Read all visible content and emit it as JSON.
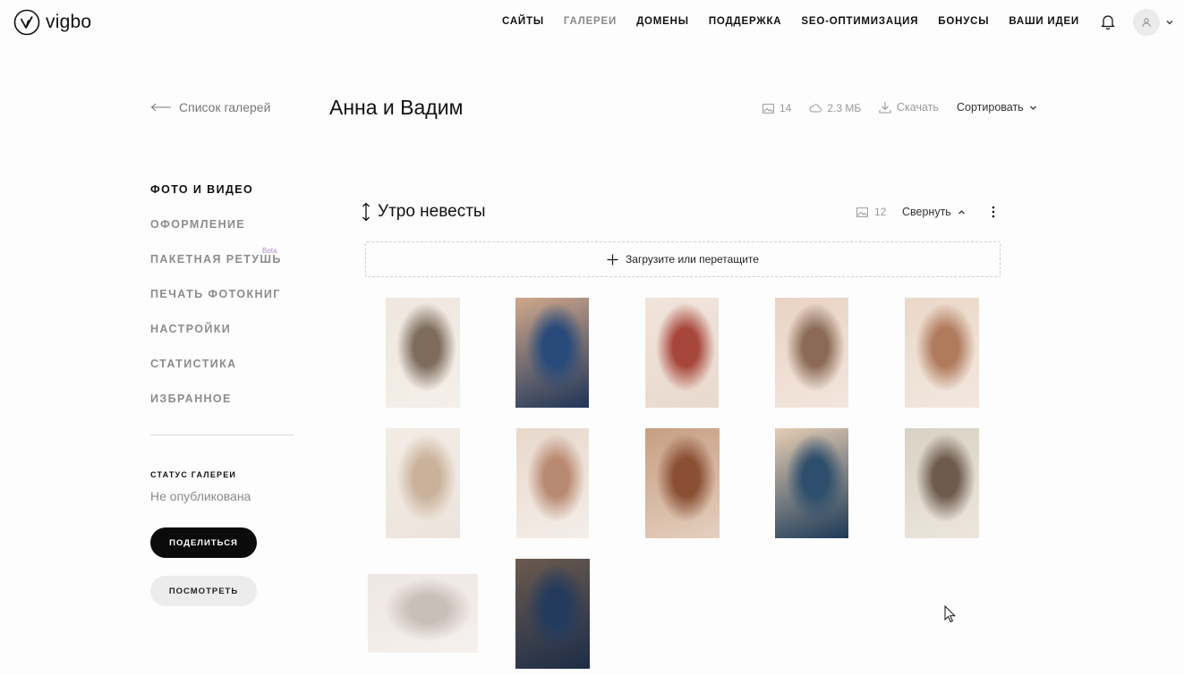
{
  "header": {
    "logo_text": "vigbo",
    "nav": [
      {
        "label": "САЙТЫ",
        "active": false
      },
      {
        "label": "ГАЛЕРЕИ",
        "active": true
      },
      {
        "label": "ДОМЕНЫ",
        "active": false
      },
      {
        "label": "ПОДДЕРЖКА",
        "active": false
      },
      {
        "label": "SEO-ОПТИМИЗАЦИЯ",
        "active": false
      },
      {
        "label": "БОНУСЫ",
        "active": false
      },
      {
        "label": "ВАШИ ИДЕИ",
        "active": false
      }
    ],
    "icons": {
      "notifications": "bell-icon",
      "user": "user-icon",
      "menu": "chevron-down-icon"
    }
  },
  "toolbar": {
    "back_label": "Список галерей",
    "gallery_title": "Анна и Вадим",
    "photo_count": "14",
    "size": "2.3 МБ",
    "download_label": "Скачать",
    "sort_label": "Сортировать"
  },
  "sidebar": {
    "items": [
      {
        "label": "ФОТО И ВИДЕО",
        "active": true
      },
      {
        "label": "ОФОРМЛЕНИЕ",
        "active": false
      },
      {
        "label": "ПАКЕТНАЯ РЕТУШЬ",
        "active": false,
        "badge": "Beta"
      },
      {
        "label": "ПЕЧАТЬ ФОТОКНИГ",
        "active": false
      },
      {
        "label": "НАСТРОЙКИ",
        "active": false
      },
      {
        "label": "СТАТИСТИКА",
        "active": false
      },
      {
        "label": "ИЗБРАННОЕ",
        "active": false
      }
    ],
    "status_label": "СТАТУС ГАЛЕРЕИ",
    "status_value": "Не опубликована",
    "share_label": "ПОДЕЛИТЬСЯ",
    "view_label": "ПОСМОТРЕТЬ"
  },
  "section": {
    "title": "Утро невесты",
    "count": "12",
    "collapse_label": "Свернуть",
    "upload_label": "Загрузите или перетащите"
  },
  "photos": [
    {
      "name": "photo-bride-mirror",
      "colors": [
        "#efe7df",
        "#7d6b5c",
        "#f4efe9"
      ]
    },
    {
      "name": "photo-groom-suit",
      "colors": [
        "#cfa88c",
        "#274a7a",
        "#1f3558"
      ]
    },
    {
      "name": "photo-red-shoes",
      "colors": [
        "#f1e4db",
        "#a7463b",
        "#e9d9cd"
      ]
    },
    {
      "name": "photo-rings-table",
      "colors": [
        "#e9d3c4",
        "#8b6b58",
        "#f3e6dd"
      ]
    },
    {
      "name": "photo-dress-lace-back",
      "colors": [
        "#ead8c8",
        "#b07a5c",
        "#f2e8e0"
      ]
    },
    {
      "name": "photo-bride-window",
      "colors": [
        "#f3ece5",
        "#c9b19a",
        "#ece4dc"
      ]
    },
    {
      "name": "photo-dress-buttons",
      "colors": [
        "#e8d8cc",
        "#b98a72",
        "#f4eee9"
      ]
    },
    {
      "name": "photo-mirror-shoes",
      "colors": [
        "#c79f82",
        "#8a4f35",
        "#e4cfbf"
      ]
    },
    {
      "name": "photo-dress-bed",
      "colors": [
        "#e6cdb4",
        "#2d4e6c",
        "#1c3a57"
      ]
    },
    {
      "name": "photo-bride-portrait",
      "colors": [
        "#d8d2c4",
        "#6f5b4e",
        "#ede6dd"
      ]
    },
    {
      "name": "photo-shoes-floor",
      "colors": [
        "#eee6e2",
        "#c9bfb9",
        "#f5f1ee"
      ]
    },
    {
      "name": "photo-groom-cufflinks",
      "colors": [
        "#6b5a4e",
        "#253b5e",
        "#1d2d48"
      ]
    }
  ]
}
